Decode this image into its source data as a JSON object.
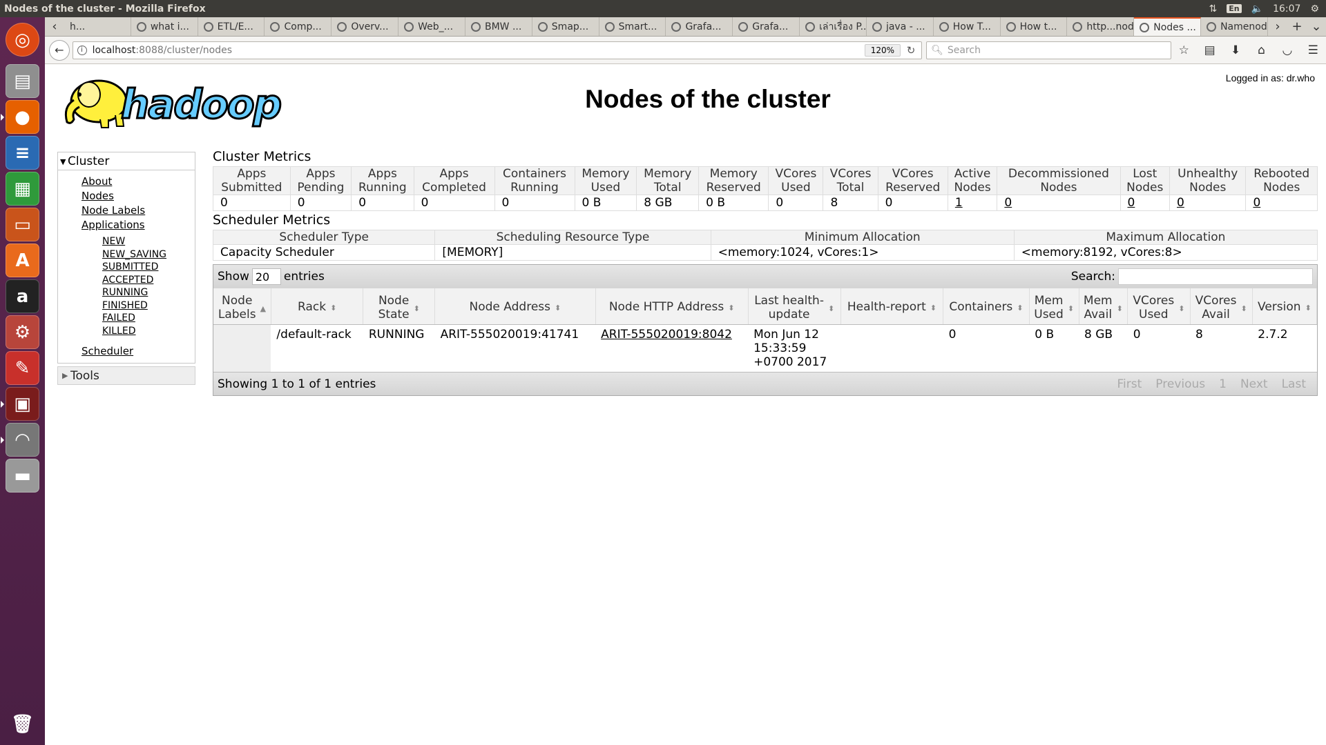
{
  "os": {
    "window_title": "Nodes of the cluster - Mozilla Firefox",
    "lang": "En",
    "clock": "16:07"
  },
  "tabs": [
    {
      "label": "h..."
    },
    {
      "label": "what i..."
    },
    {
      "label": "ETL/E..."
    },
    {
      "label": "Comp..."
    },
    {
      "label": "Overv..."
    },
    {
      "label": "Web_..."
    },
    {
      "label": "BMW ..."
    },
    {
      "label": "Smap..."
    },
    {
      "label": "Smart..."
    },
    {
      "label": "Grafa..."
    },
    {
      "label": "Grafa..."
    },
    {
      "label": "เล่าเรื่อง P..."
    },
    {
      "label": "java - ..."
    },
    {
      "label": "How T..."
    },
    {
      "label": "How t..."
    },
    {
      "label": "http...node"
    },
    {
      "label": "Nodes ..."
    },
    {
      "label": "Namenod..."
    }
  ],
  "nav": {
    "url_host": "localhost",
    "url_path": ":8088/cluster/nodes",
    "zoom": "120%",
    "search_placeholder": "Search"
  },
  "page": {
    "title": "Nodes of the cluster",
    "logged_in": "Logged in as: dr.who",
    "logo_text": "hadoop"
  },
  "sidebar": {
    "cluster_label": "Cluster",
    "links": [
      "About",
      "Nodes",
      "Node Labels",
      "Applications"
    ],
    "app_states": [
      "NEW",
      "NEW_SAVING",
      "SUBMITTED",
      "ACCEPTED",
      "RUNNING",
      "FINISHED",
      "FAILED",
      "KILLED"
    ],
    "scheduler": "Scheduler",
    "tools_label": "Tools"
  },
  "cluster_metrics": {
    "title": "Cluster Metrics",
    "headers": [
      [
        "Apps",
        "Submitted"
      ],
      [
        "Apps",
        "Pending"
      ],
      [
        "Apps",
        "Running"
      ],
      [
        "Apps",
        "Completed"
      ],
      [
        "Containers",
        "Running"
      ],
      [
        "Memory",
        "Used"
      ],
      [
        "Memory",
        "Total"
      ],
      [
        "Memory",
        "Reserved"
      ],
      [
        "VCores",
        "Used"
      ],
      [
        "VCores",
        "Total"
      ],
      [
        "VCores",
        "Reserved"
      ],
      [
        "Active",
        "Nodes"
      ],
      [
        "Decommissioned",
        "Nodes"
      ],
      [
        "Lost",
        "Nodes"
      ],
      [
        "Unhealthy",
        "Nodes"
      ],
      [
        "Rebooted",
        "Nodes"
      ]
    ],
    "values": [
      "0",
      "0",
      "0",
      "0",
      "0",
      "0 B",
      "8 GB",
      "0 B",
      "0",
      "8",
      "0",
      "1",
      "0",
      "0",
      "0",
      "0"
    ]
  },
  "scheduler_metrics": {
    "title": "Scheduler Metrics",
    "headers": [
      "Scheduler Type",
      "Scheduling Resource Type",
      "Minimum Allocation",
      "Maximum Allocation"
    ],
    "values": [
      "Capacity Scheduler",
      "[MEMORY]",
      "<memory:1024, vCores:1>",
      "<memory:8192, vCores:8>"
    ]
  },
  "nodes_table": {
    "show_label": "Show",
    "show_value": "20",
    "entries_label": "entries",
    "search_label": "Search:",
    "headers": [
      [
        "Node",
        "Labels"
      ],
      [
        "Rack"
      ],
      [
        "Node",
        "State"
      ],
      [
        "Node Address"
      ],
      [
        "Node HTTP Address"
      ],
      [
        "Last health-",
        "update"
      ],
      [
        "Health-report"
      ],
      [
        "Containers"
      ],
      [
        "Mem",
        "Used"
      ],
      [
        "Mem",
        "Avail"
      ],
      [
        "VCores",
        "Used"
      ],
      [
        "VCores",
        "Avail"
      ],
      [
        "Version"
      ]
    ],
    "rows": [
      {
        "labels": "",
        "rack": "/default-rack",
        "state": "RUNNING",
        "address": "ARIT-555020019:41741",
        "http_address": "ARIT-555020019:8042",
        "last_update_1": "Mon Jun 12",
        "last_update_2": "15:33:59",
        "last_update_3": "+0700 2017",
        "health_report": "",
        "containers": "0",
        "mem_used": "0 B",
        "mem_avail": "8 GB",
        "vcores_used": "0",
        "vcores_avail": "8",
        "version": "2.7.2"
      }
    ],
    "showing": "Showing 1 to 1 of 1 entries",
    "pager": [
      "First",
      "Previous",
      "1",
      "Next",
      "Last"
    ]
  }
}
